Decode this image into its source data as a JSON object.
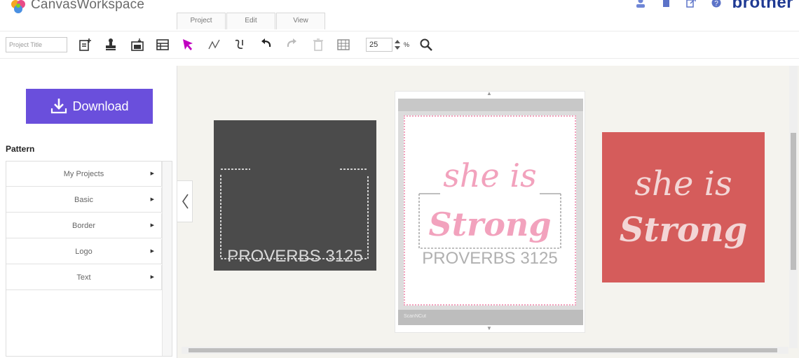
{
  "header": {
    "app_title": "CanvasWorkspace",
    "brand": "brother",
    "tabs": [
      {
        "label": "Project"
      },
      {
        "label": "Edit"
      },
      {
        "label": "View"
      }
    ],
    "icons": [
      "user-icon",
      "document-icon",
      "export-icon",
      "help-icon"
    ]
  },
  "toolbar": {
    "project_title_placeholder": "Project Title",
    "zoom_value": "25",
    "zoom_unit": "%",
    "tools": [
      "new-project-icon",
      "stamp-icon",
      "import-icon",
      "template-icon",
      "select-arrow-icon",
      "draw-line-icon",
      "freehand-icon",
      "undo-icon",
      "redo-icon",
      "delete-icon",
      "grid-icon",
      "zoom-search-icon"
    ]
  },
  "sidebar": {
    "download_label": "Download",
    "pattern_heading": "Pattern",
    "pattern_items": [
      {
        "label": "My Projects"
      },
      {
        "label": "Basic"
      },
      {
        "label": "Border"
      },
      {
        "label": "Logo"
      },
      {
        "label": "Text"
      }
    ]
  },
  "canvas": {
    "designs": [
      {
        "name": "dark-frame-design",
        "text": "PROVERBS 3125",
        "background": "#4b4b4b"
      },
      {
        "name": "mat-preview",
        "line1": "she is",
        "line2": "Strong",
        "line3": "PROVERBS 3125",
        "accent": "#f2a2bd"
      },
      {
        "name": "red-design",
        "line1": "she is",
        "line2": "Strong",
        "background": "#d55c5b"
      }
    ],
    "mat_label": "ScanNCut"
  },
  "colors": {
    "download_button": "#6a4fdc",
    "brand": "#1f3a93",
    "select_tool": "#c000c0"
  }
}
